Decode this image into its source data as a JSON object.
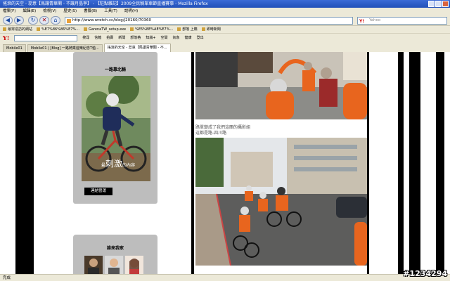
{
  "window": {
    "title": "搖滾的天空 - 蕊意【馬讓青華閣 - 不讓月晶爭】 - 【駐點雜記】2009全民騎單車節直播賽事 - Mozilla Firefox"
  },
  "menu": [
    "檔案(F)",
    "編輯(E)",
    "檢視(V)",
    "歷史(S)",
    "書籤(B)",
    "工具(T)",
    "說明(H)"
  ],
  "nav": {
    "url": "http://www.wretch.cc/blog/j20160/70360",
    "search_placeholder": "Yahoo"
  },
  "bookmarks": [
    "最常造訪的網站",
    "%E7%86%86%E7%...",
    "GarenaTW_setup.exe",
    "%E5%8E%AE%E7%...",
    "部落 上籍",
    "即時新聞"
  ],
  "yahoo_toolbar": {
    "logo": "Y!",
    "items": [
      "搜尋",
      "信箱",
      "拍賣",
      "新聞",
      "部落格",
      "知識+",
      "空間",
      "氣象",
      "健康",
      "登出"
    ]
  },
  "tabs": [
    {
      "label": "Mobile01",
      "active": false
    },
    {
      "label": "Mobile01 | [Blog] 一路騎乘遊樂紀念T恤...",
      "active": false
    },
    {
      "label": "搖滾的天空 - 蕊意【馬讓青華閣 - 不...",
      "active": true
    }
  ],
  "sidebar": {
    "panel1_title": "一路靠北騎",
    "hero_slogan_prefix": "最",
    "hero_slogan_big": "刺激",
    "hero_slogan_suffix": "的內容",
    "join_button": "連結營運",
    "panel2_title": "誰來我家"
  },
  "post": {
    "caption_line1": "路單變成了我們這團的攝影組",
    "caption_line2": "這都是路-四川路"
  },
  "status": "完成",
  "watermark": "#1234294",
  "colors": {
    "jersey": "#e8651e",
    "stripe": "#000000",
    "panel": "#bdbdbd"
  }
}
